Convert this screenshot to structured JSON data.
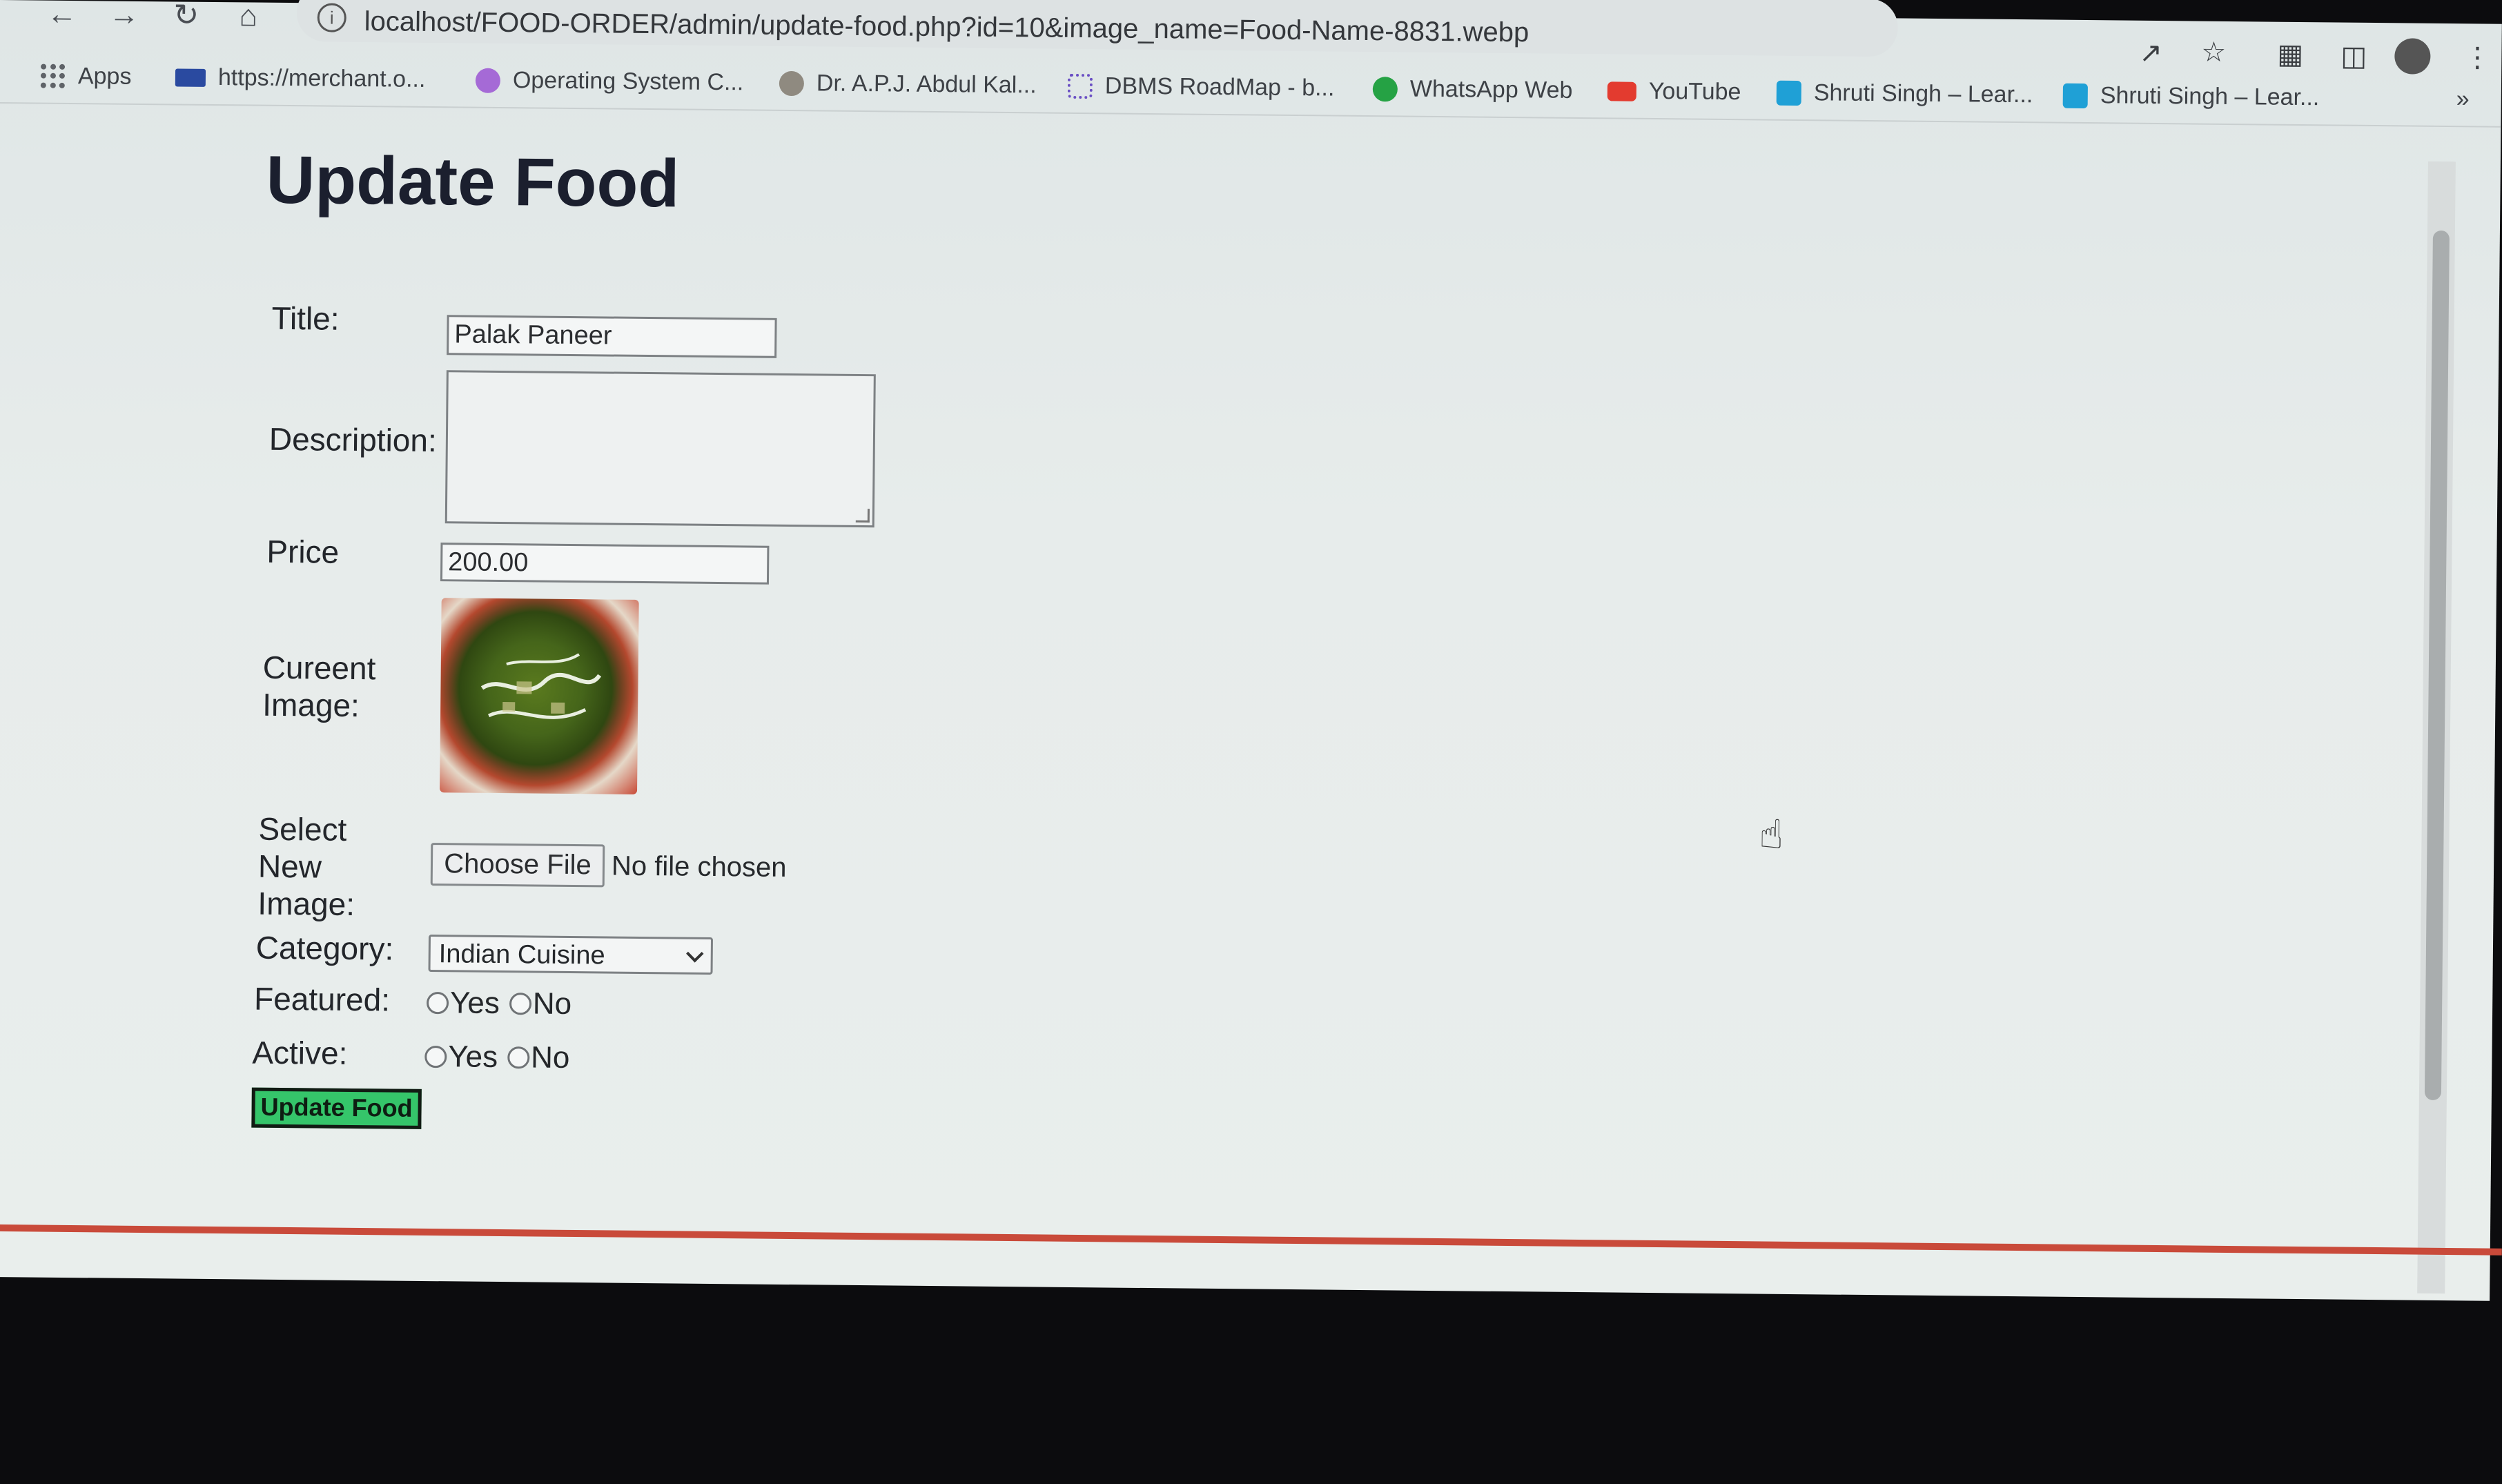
{
  "browser": {
    "url": "localhost/FOOD-ORDER/admin/update-food.php?id=10&image_name=Food-Name-8831.webp",
    "bookmarks": [
      {
        "label": "Apps",
        "icon": "apps-grid-icon"
      },
      {
        "label": "https://merchant.o...",
        "icon": "merchant-icon"
      },
      {
        "label": "Operating System C...",
        "icon": "m-circle-icon",
        "color": "#a56ad6"
      },
      {
        "label": "Dr. A.P.J. Abdul Kal...",
        "icon": "portrait-icon"
      },
      {
        "label": "DBMS RoadMap - b...",
        "icon": "roadmap-icon"
      },
      {
        "label": "WhatsApp Web",
        "icon": "whatsapp-icon",
        "color": "#25a244"
      },
      {
        "label": "YouTube",
        "icon": "youtube-icon",
        "color": "#e33b2f"
      },
      {
        "label": "Shruti Singh – Lear...",
        "icon": "shruti-icon",
        "color": "#1fa0d6"
      },
      {
        "label": "Shruti Singh – Lear...",
        "icon": "shruti-icon",
        "color": "#1fa0d6"
      }
    ],
    "more_bookmarks": "»"
  },
  "page": {
    "title": "Update Food",
    "form": {
      "title_label": "Title:",
      "title_value": "Palak Paneer",
      "description_label": "Description:",
      "description_value": "",
      "price_label": "Price",
      "price_value": "200.00",
      "current_image_label_1": "Cureent",
      "current_image_label_2": "Image:",
      "select_image_label_1": "Select",
      "select_image_label_2": "New",
      "select_image_label_3": "Image:",
      "choose_file_label": "Choose File",
      "file_status": "No file chosen",
      "category_label": "Category:",
      "category_value": "Indian Cuisine",
      "featured_label": "Featured:",
      "active_label": "Active:",
      "yes_label": "Yes",
      "no_label": "No",
      "submit_label": "Update Food"
    }
  },
  "colors": {
    "submit_bg": "#35c56a",
    "page_bg": "#e7eceb"
  }
}
